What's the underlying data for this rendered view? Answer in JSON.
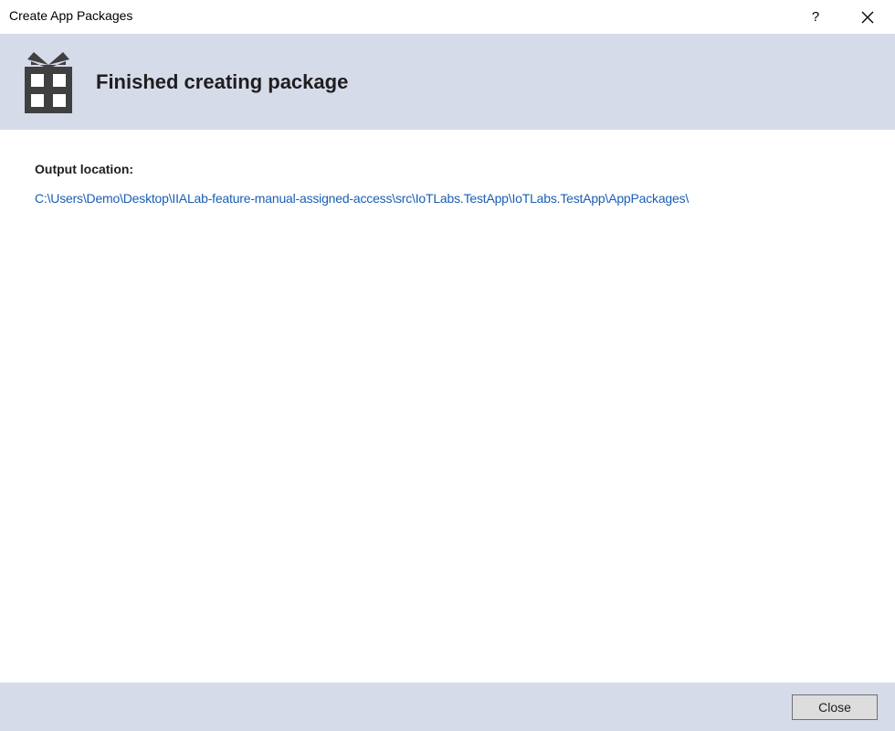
{
  "window": {
    "title": "Create App Packages",
    "help_label": "?"
  },
  "header": {
    "icon": "gift-icon",
    "title": "Finished creating package"
  },
  "content": {
    "output_label": "Output location:",
    "output_path": "C:\\Users\\Demo\\Desktop\\IIALab-feature-manual-assigned-access\\src\\IoTLabs.TestApp\\IoTLabs.TestApp\\AppPackages\\"
  },
  "footer": {
    "close_label": "Close"
  },
  "colors": {
    "band_background": "#d6dbe9",
    "link": "#1a5fb4",
    "icon": "#404040"
  }
}
